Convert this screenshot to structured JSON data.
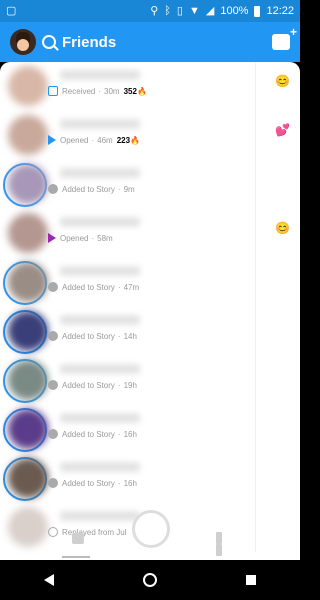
{
  "status_bar": {
    "time": "12:22",
    "battery": "100%"
  },
  "header": {
    "title": "Friends"
  },
  "rows": [
    {
      "status": "Received",
      "time": "30m",
      "streak": "352",
      "streak_icon": "🔥",
      "emoji": "😊",
      "status_kind": "received",
      "avatar_color": "#d8b7a7"
    },
    {
      "status": "Opened",
      "time": "46m",
      "streak": "223",
      "streak_icon": "🔥",
      "emoji": "💕",
      "status_kind": "opened-blue",
      "avatar_color": "#c9a99b"
    },
    {
      "status": "Added to Story",
      "time": "9m",
      "status_kind": "story",
      "avatar_color": "#a897b8"
    },
    {
      "status": "Opened",
      "time": "58m",
      "emoji": "😊",
      "status_kind": "opened-purple",
      "avatar_color": "#b49790"
    },
    {
      "status": "Added to Story",
      "time": "47m",
      "status_kind": "story",
      "avatar_color": "#9a8d85"
    },
    {
      "status": "Added to Story",
      "time": "14h",
      "status_kind": "story",
      "avatar_color": "#3a3f7a"
    },
    {
      "status": "Added to Story",
      "time": "19h",
      "status_kind": "story",
      "avatar_color": "#7a8a84"
    },
    {
      "status": "Added to Story",
      "time": "16h",
      "status_kind": "story",
      "avatar_color": "#5a3c8a"
    },
    {
      "status": "Added to Story",
      "time": "16h",
      "status_kind": "story",
      "avatar_color": "#6a5a50"
    },
    {
      "status": "Replayed from Jul",
      "time": "",
      "status_kind": "replayed",
      "avatar_color": "#d9cfcb"
    }
  ],
  "colors": {
    "accent": "#2196f3",
    "status_bar": "#1a86d6"
  }
}
